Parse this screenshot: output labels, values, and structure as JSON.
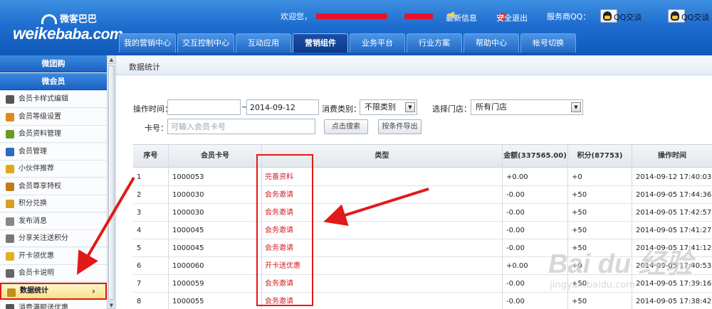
{
  "logo": {
    "wordmark_a": "weike",
    "wordmark_b": "baba.com",
    "cn_name": "微客巴巴"
  },
  "topbar": {
    "welcome": "欢迎您，",
    "latest_news": "最新信息",
    "logout": "安全退出",
    "service_qq_label": "服务商QQ：",
    "qq_chat_1": "QQ交谈",
    "qq_chat_2": "QQ交谈"
  },
  "nav": {
    "tabs": [
      "我的营销中心",
      "交互控制中心",
      "互动应用",
      "营销组件",
      "业务平台",
      "行业方案",
      "帮助中心",
      "帐号切换"
    ],
    "active_index": 3
  },
  "sidebar": {
    "groups": [
      "微团购",
      "微会员"
    ],
    "items": [
      {
        "label": "会员卡样式编辑",
        "icon": "grid-icon",
        "color": "#555"
      },
      {
        "label": "会员等级设置",
        "icon": "medal-icon",
        "color": "#e08a1a"
      },
      {
        "label": "会员资料管理",
        "icon": "list-icon",
        "color": "#6a9a2a"
      },
      {
        "label": "会员管理",
        "icon": "user-icon",
        "color": "#2a6ac0"
      },
      {
        "label": "小伙伴推荐",
        "icon": "thumb-icon",
        "color": "#e0a81a"
      },
      {
        "label": "会员尊享特权",
        "icon": "crown-user-icon",
        "color": "#c07a1a"
      },
      {
        "label": "积分兑换",
        "icon": "coin-icon",
        "color": "#d8a020"
      },
      {
        "label": "发布消息",
        "icon": "edit-icon",
        "color": "#888"
      },
      {
        "label": "分享关注送积分",
        "icon": "share-icon",
        "color": "#777"
      },
      {
        "label": "开卡领优惠",
        "icon": "lock-icon",
        "color": "#e0b020"
      },
      {
        "label": "会员卡说明",
        "icon": "doc-icon",
        "color": "#666"
      },
      {
        "label": "数据统计",
        "icon": "chart-icon",
        "color": "#c09020"
      },
      {
        "label": "消费满额送优惠",
        "icon": "grid-icon",
        "color": "#555"
      }
    ],
    "active_index": 11,
    "active_chevron": "›"
  },
  "main": {
    "breadcrumb": "数据统计",
    "filters": {
      "op_time_label": "操作时间：",
      "op_time_from": "",
      "tilde": "~",
      "op_time_to": "2014-09-12",
      "consume_type_label": "消费类别：",
      "consume_type_value": "不限类别",
      "store_label": "选择门店：",
      "store_value": "所有门店",
      "card_label": "卡号：",
      "card_placeholder": "可输入会员卡号",
      "search_button": "点击搜索",
      "export_button": "按条件导出"
    },
    "table": {
      "headers": [
        "序号",
        "会员卡号",
        "类型",
        "金额(337565.00)",
        "积分(87753)",
        "操作时间"
      ],
      "rows": [
        [
          "1",
          "1000053",
          "完善资料",
          "+0.00",
          "+0",
          "2014-09-12 17:40:03"
        ],
        [
          "2",
          "1000030",
          "会务邀请",
          "-0.00",
          "+50",
          "2014-09-05 17:44:36"
        ],
        [
          "3",
          "1000030",
          "会务邀请",
          "-0.00",
          "+50",
          "2014-09-05 17:42:57"
        ],
        [
          "4",
          "1000045",
          "会务邀请",
          "-0.00",
          "+50",
          "2014-09-05 17:41:27"
        ],
        [
          "5",
          "1000045",
          "会务邀请",
          "-0.00",
          "+50",
          "2014-09-05 17:41:12"
        ],
        [
          "6",
          "1000060",
          "开卡送优惠",
          "+0.00",
          "+0",
          "2014-09-05 17:40:53"
        ],
        [
          "7",
          "1000059",
          "会务邀请",
          "-0.00",
          "+50",
          "2014-09-05 17:39:16"
        ],
        [
          "8",
          "1000055",
          "会务邀请",
          "-0.00",
          "+50",
          "2014-09-05 17:38:42"
        ]
      ]
    }
  },
  "watermark": {
    "big": "Bai du 经验",
    "small": "jingyan.baidu.com"
  },
  "colors": {
    "header_blue": "#1f6ed0",
    "annotation_red": "#e01a1a",
    "type_red": "#d0202a"
  }
}
